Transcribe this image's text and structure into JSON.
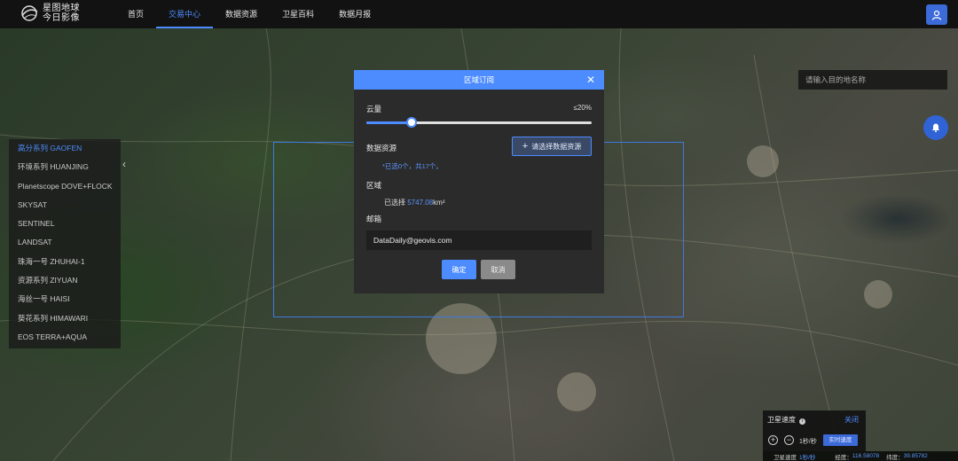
{
  "header": {
    "logo_line1": "星图地球",
    "logo_line2": "今日影像",
    "nav": [
      {
        "label": "首页",
        "active": false
      },
      {
        "label": "交易中心",
        "active": true
      },
      {
        "label": "数据资源",
        "active": false
      },
      {
        "label": "卫星百科",
        "active": false
      },
      {
        "label": "数据月报",
        "active": false
      }
    ]
  },
  "sidebar": {
    "items": [
      {
        "label": "高分系列 GAOFEN",
        "active": true
      },
      {
        "label": "环境系列 HUANJING",
        "active": false
      },
      {
        "label": "Planetscope DOVE+FLOCK",
        "active": false
      },
      {
        "label": "SKYSAT",
        "active": false
      },
      {
        "label": "SENTINEL",
        "active": false
      },
      {
        "label": "LANDSAT",
        "active": false
      },
      {
        "label": "珠海一号 ZHUHAI-1",
        "active": false
      },
      {
        "label": "资源系列 ZIYUAN",
        "active": false
      },
      {
        "label": "海丝一号 HAISI",
        "active": false
      },
      {
        "label": "葵花系列 HIMAWARI",
        "active": false
      },
      {
        "label": "EOS TERRA+AQUA",
        "active": false
      }
    ]
  },
  "search": {
    "placeholder": "请输入目的地名称"
  },
  "dialog": {
    "title": "区域订阅",
    "cloud_label": "云量",
    "cloud_value": "≤20%",
    "cloud_fraction": 0.2,
    "data_source_label": "数据资源",
    "pick_button": "请选择数据资源",
    "hint": "*已选0个，共17个。",
    "area_label": "区域",
    "area_prefix": "已选择",
    "area_value": "5747.08",
    "area_unit": "km²",
    "email_label": "邮箱",
    "email_value": "DataDaily@geovis.com",
    "ok_label": "确定",
    "cancel_label": "取消"
  },
  "sat_panel": {
    "title": "卫星速度",
    "close_label": "关闭",
    "speed": "1秒/秒",
    "realtime_button": "实时速度"
  },
  "status": {
    "sat_speed_label": "卫星速度",
    "sat_speed_value": "1秒/秒",
    "lon_label": "经度：",
    "lon_value": "116.58078",
    "lat_label": "纬度：",
    "lat_value": "39.85782"
  },
  "colors": {
    "accent": "#4d8cff",
    "topbar": "#121212",
    "dialog_bg": "#2b2b2b"
  }
}
